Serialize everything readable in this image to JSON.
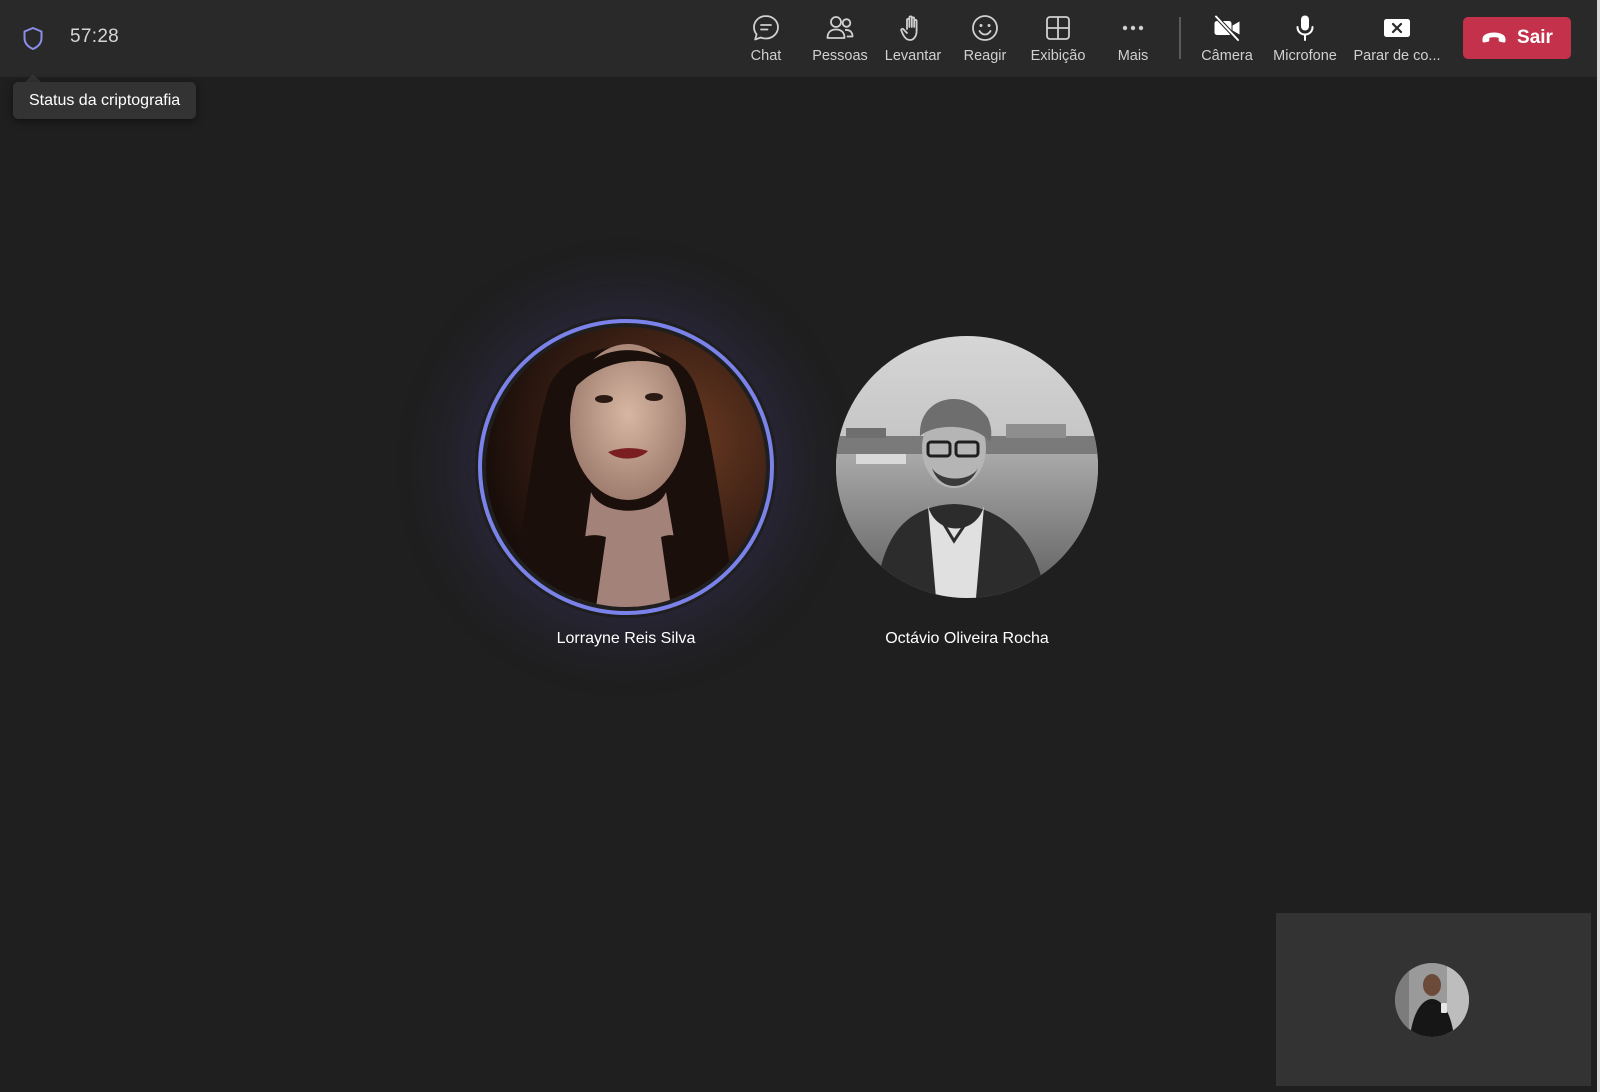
{
  "meeting": {
    "timer": "57:28",
    "encryption_tooltip": "Status da criptografia"
  },
  "toolbar": {
    "items": [
      {
        "label": "Chat",
        "icon": "chat-icon"
      },
      {
        "label": "Pessoas",
        "icon": "people-icon"
      },
      {
        "label": "Levantar",
        "icon": "raise-hand-icon"
      },
      {
        "label": "Reagir",
        "icon": "smiley-icon"
      },
      {
        "label": "Exibição",
        "icon": "grid-view-icon"
      },
      {
        "label": "Mais",
        "icon": "more-dots-icon"
      },
      {
        "label": "Câmera",
        "icon": "camera-off-icon"
      },
      {
        "label": "Microfone",
        "icon": "microphone-icon"
      },
      {
        "label": "Parar de co...",
        "icon": "stop-share-icon"
      }
    ],
    "leave_label": "Sair"
  },
  "participants": [
    {
      "name": "Lorrayne Reis Silva",
      "speaking": true
    },
    {
      "name": "Octávio Oliveira Rocha",
      "speaking": false
    }
  ],
  "colors": {
    "background": "#1f1f1f",
    "topbar": "#292929",
    "accent": "#7b83eb",
    "leave": "#c4314b"
  }
}
